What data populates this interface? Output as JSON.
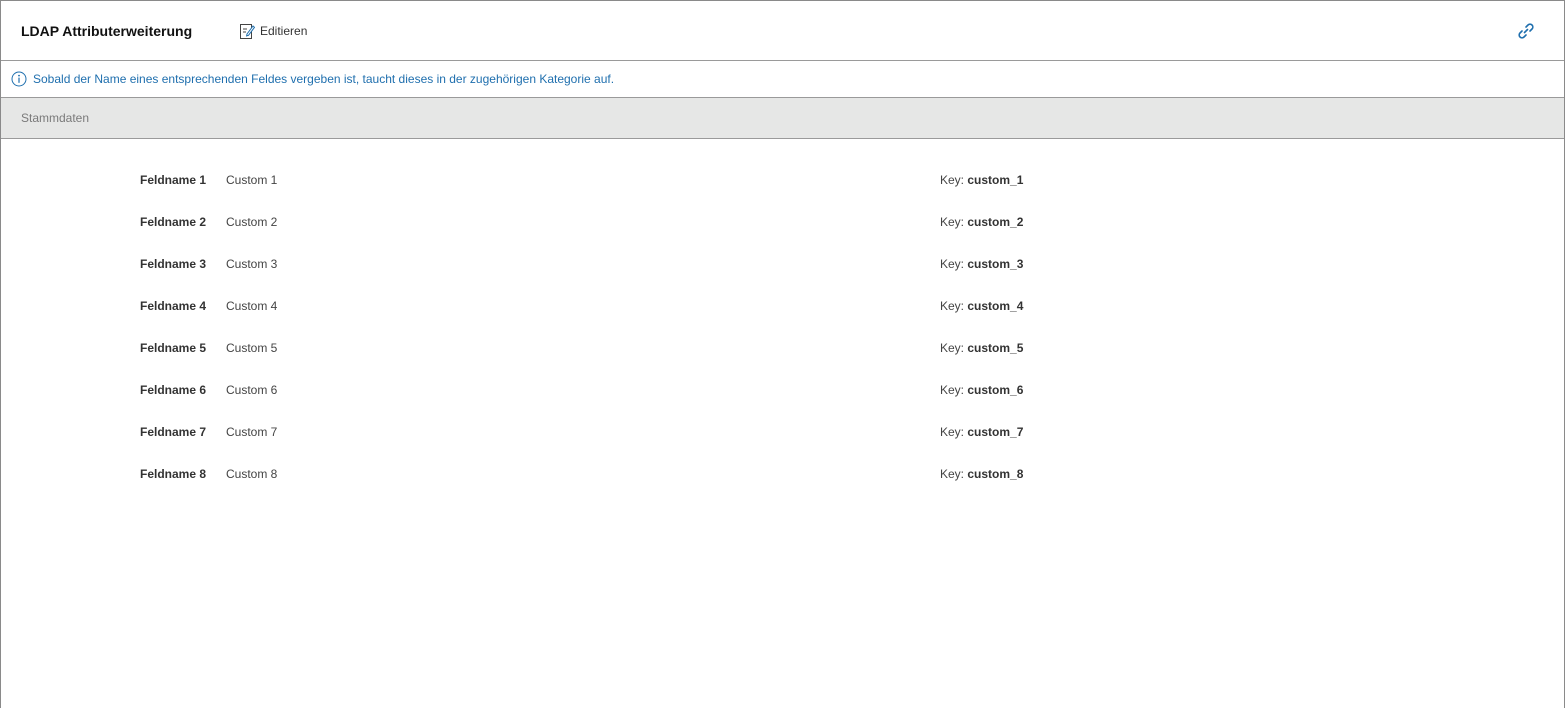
{
  "header": {
    "title": "LDAP Attributerweiterung",
    "edit_label": "Editieren",
    "edit_icon": "edit-icon",
    "link_icon": "link-icon"
  },
  "info": {
    "icon": "info-icon",
    "text": "Sobald der Name eines entsprechenden Feldes vergeben ist, taucht dieses in der zugehörigen Kategorie auf."
  },
  "section": {
    "title": "Stammdaten"
  },
  "fields": [
    {
      "label": "Feldname 1",
      "value": "Custom 1",
      "key_prefix": "Key:",
      "key": "custom_1"
    },
    {
      "label": "Feldname 2",
      "value": "Custom 2",
      "key_prefix": "Key:",
      "key": "custom_2"
    },
    {
      "label": "Feldname 3",
      "value": "Custom 3",
      "key_prefix": "Key:",
      "key": "custom_3"
    },
    {
      "label": "Feldname 4",
      "value": "Custom 4",
      "key_prefix": "Key:",
      "key": "custom_4"
    },
    {
      "label": "Feldname 5",
      "value": "Custom 5",
      "key_prefix": "Key:",
      "key": "custom_5"
    },
    {
      "label": "Feldname 6",
      "value": "Custom 6",
      "key_prefix": "Key:",
      "key": "custom_6"
    },
    {
      "label": "Feldname 7",
      "value": "Custom 7",
      "key_prefix": "Key:",
      "key": "custom_7"
    },
    {
      "label": "Feldname 8",
      "value": "Custom 8",
      "key_prefix": "Key:",
      "key": "custom_8"
    }
  ],
  "colors": {
    "accent": "#1f6fae",
    "section_bg": "#e6e7e6"
  }
}
